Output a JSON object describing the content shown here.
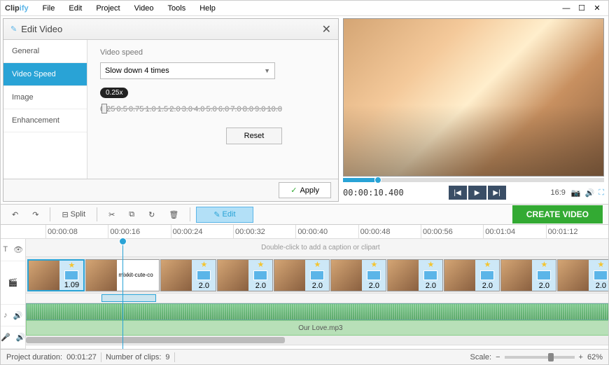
{
  "app": {
    "name_a": "Clip",
    "name_b": "ify"
  },
  "menu": [
    "File",
    "Edit",
    "Project",
    "Video",
    "Tools",
    "Help"
  ],
  "editPanel": {
    "title": "Edit Video",
    "tabs": [
      "General",
      "Video Speed",
      "Image",
      "Enhancement"
    ],
    "section": "Video speed",
    "dropdown": "Slow down 4 times",
    "badge": "0.25x",
    "ticks": [
      "0.25",
      "0.5",
      "0.75",
      "1.0",
      "1.5",
      "2.0",
      "3.0",
      "4.0",
      "5.0",
      "6.0",
      "7.0",
      "8.0",
      "9.0",
      "10.0"
    ],
    "reset": "Reset",
    "apply": "Apply"
  },
  "preview": {
    "timecode": "00:00:10.400",
    "aspect": "16:9"
  },
  "toolbar": {
    "split": "Split",
    "edit": "Edit",
    "create": "CREATE VIDEO"
  },
  "ruler": [
    "00:00:08",
    "00:00:16",
    "00:00:24",
    "00:00:32",
    "00:00:40",
    "00:00:48",
    "00:00:56",
    "00:01:04",
    "00:01:12"
  ],
  "captionHint": "Double-click to add a caption or clipart",
  "clips": [
    {
      "dur": "1.09",
      "sel": true
    },
    {
      "dur": "",
      "label": "mixkit-cute-co"
    },
    {
      "dur": "2.0"
    },
    {
      "dur": "2.0"
    },
    {
      "dur": "2.0"
    },
    {
      "dur": "2.0"
    },
    {
      "dur": "2.0"
    },
    {
      "dur": "2.0"
    },
    {
      "dur": "2.0"
    },
    {
      "dur": "2.0"
    }
  ],
  "music": "Our Love.mp3",
  "status": {
    "durLabel": "Project duration:",
    "dur": "00:01:27",
    "clipsLabel": "Number of clips:",
    "clips": "9",
    "scaleLabel": "Scale:",
    "zoom": "62%"
  }
}
